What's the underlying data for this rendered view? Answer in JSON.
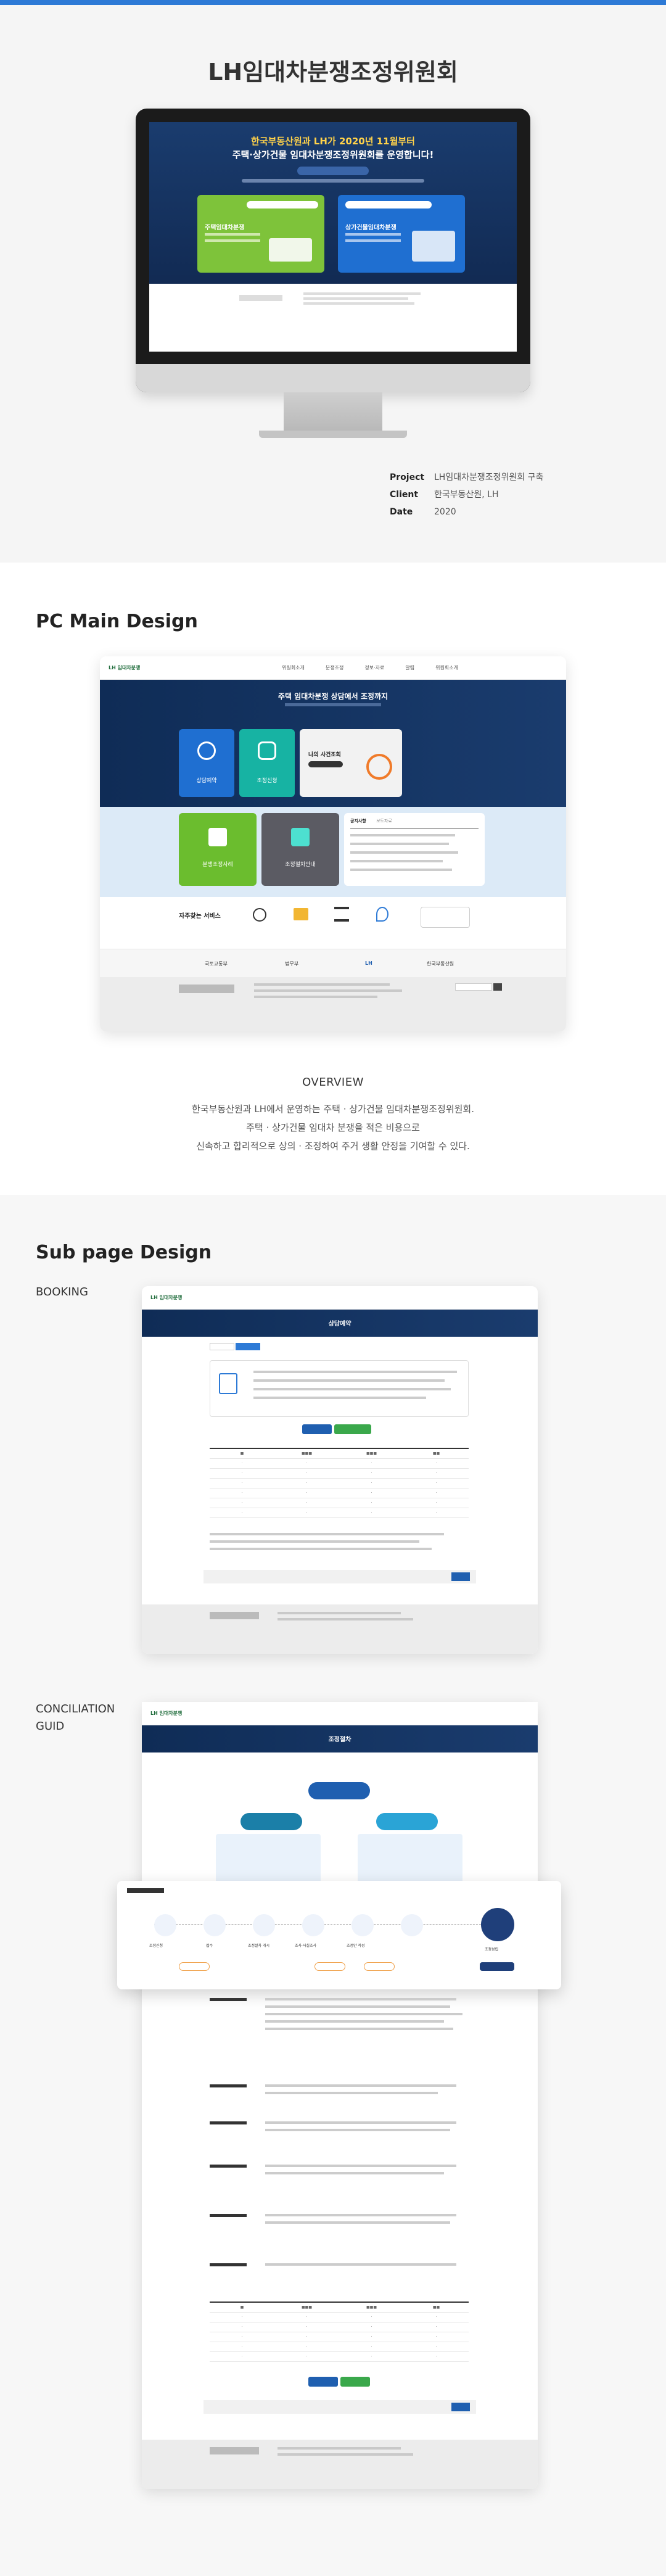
{
  "hero": {
    "title": "LH임대차분쟁조정위원회",
    "banner_line1": "한국부동산원과 LH가 2020년 11월부터",
    "banner_line2": "주택·상가건물 임대차분쟁조정위원회를 운영합니다!",
    "card_left": "주택임대차분쟁",
    "card_right": "상가건물임대차분쟁",
    "meta": [
      {
        "key": "Project",
        "value": "LH임대차분쟁조정위원회 구축"
      },
      {
        "key": "Client",
        "value": "한국부동산원, LH"
      },
      {
        "key": "Date",
        "value": "2020"
      }
    ]
  },
  "pc": {
    "heading": "PC Main Design",
    "nav": [
      "위원회소개",
      "분쟁조정",
      "정보·자료",
      "알림",
      "위원회소개"
    ],
    "banner_title": "주택 임대차분쟁 상담에서 조정까지",
    "tiles": [
      "상담예약",
      "조정신청",
      "나의 사건조회",
      "분쟁조정사례",
      "조정절차안내"
    ],
    "notice_tabs": [
      "공지사항",
      "보도자료"
    ],
    "services_label": "자주찾는 서비스",
    "partners": [
      "국토교통부",
      "법무부",
      "LH",
      "한국부동산원"
    ]
  },
  "overview": {
    "title": "OVERVIEW",
    "lines": [
      "한국부동산원과 LH에서 운영하는 주택 · 상가건물 임대차분쟁조정위원회.",
      "주택 · 상가건물 임대차 분쟁을 적은 비용으로",
      "신속하고 합리적으로 상의 · 조정하여 주거 생활 안정을 기여할 수 있다."
    ]
  },
  "sub": {
    "heading": "Sub page Design",
    "booking_label": "BOOKING",
    "booking_title": "상담예약",
    "concil_label": "CONCILIATION GUID",
    "concil_title": "조정절차",
    "steps": [
      "조정신청",
      "접수",
      "조정절차 개시",
      "조사·사실조사",
      "조정안 작성",
      "조정성립"
    ]
  }
}
